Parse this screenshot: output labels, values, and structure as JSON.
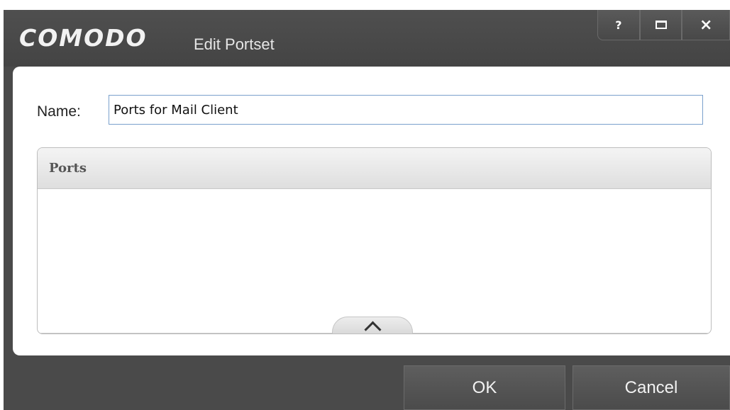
{
  "window": {
    "brand": "COMODO",
    "title": "Edit Portset",
    "controls": {
      "help": "?",
      "close": "×"
    }
  },
  "form": {
    "name_label": "Name:",
    "name_value": "Ports for Mail Client"
  },
  "ports_panel": {
    "header": "Ports",
    "items": []
  },
  "buttons": {
    "ok": "OK",
    "cancel": "Cancel"
  }
}
